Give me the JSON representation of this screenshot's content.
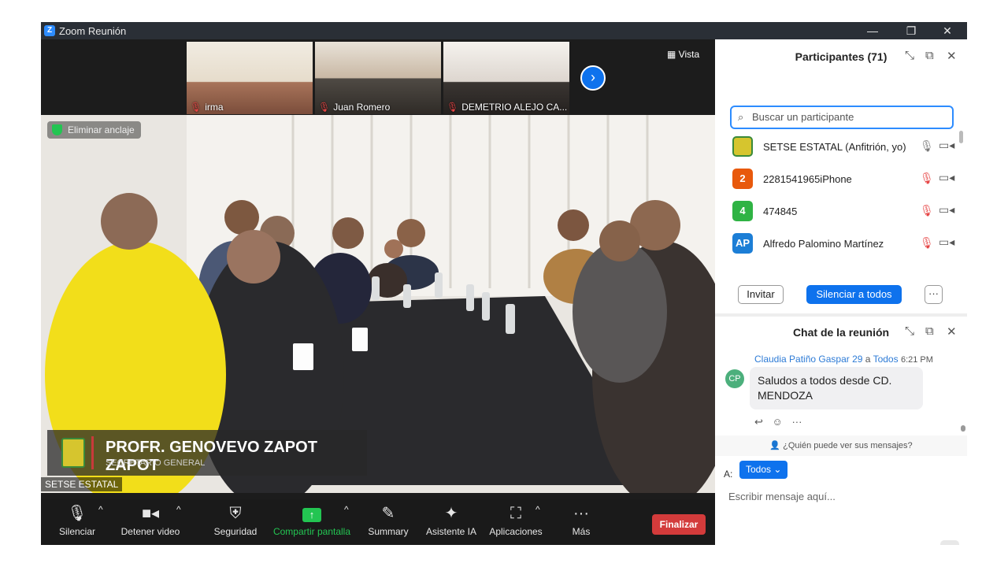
{
  "window": {
    "title": "Zoom Reunión",
    "minimize": "—",
    "restore": "❐",
    "close": "✕"
  },
  "thumbnails": [
    {
      "name": "irma"
    },
    {
      "name": "Juan Romero"
    },
    {
      "name": "DEMETRIO ALEJO CA..."
    }
  ],
  "view_label": "Vista",
  "main_video": {
    "unpin_label": "Eliminar anclaje",
    "lower_third_name": "PROFR. GENOVEVO ZAPOT ZAPOT",
    "lower_third_role": "SECRETARIO GENERAL",
    "speaker": "SETSE ESTATAL"
  },
  "toolbar": {
    "mute": "Silenciar",
    "stop_video": "Detener video",
    "security": "Seguridad",
    "share": "Compartir pantalla",
    "summary": "Summary",
    "ai": "Asistente IA",
    "apps": "Aplicaciones",
    "more": "Más",
    "end": "Finalizar"
  },
  "participants": {
    "title": "Participantes (71)",
    "search_placeholder": "Buscar un participante",
    "list": [
      {
        "avatar": "",
        "name": "SETSE ESTATAL (Anfitrión, yo)",
        "avatar_color": "#d6c52e",
        "muted": false,
        "cam_off": false
      },
      {
        "avatar": "2",
        "name": "2281541965iPhone",
        "avatar_color": "#e8590c",
        "muted": true,
        "cam_off": false
      },
      {
        "avatar": "4",
        "name": "474845",
        "avatar_color": "#2fb344",
        "muted": true,
        "cam_off": true
      },
      {
        "avatar": "AP",
        "name": "Alfredo Palomino Martínez",
        "avatar_color": "#1c7ed6",
        "muted": true,
        "cam_off": false
      }
    ],
    "invite": "Invitar",
    "mute_all": "Silenciar a todos",
    "more": "···"
  },
  "chat": {
    "title": "Chat de la reunión",
    "sender": "Claudia Patiño Gaspar 29",
    "to_word": "a",
    "recipient": "Todos",
    "time": "6:21 PM",
    "avatar": "CP",
    "message": "Saludos a todos desde CD. MENDOZA",
    "who_sees": "¿Quién puede ver sus mensajes?",
    "to_label": "A:",
    "to_value": "Todos ⌄",
    "input_placeholder": "Escribir mensaje aquí..."
  }
}
